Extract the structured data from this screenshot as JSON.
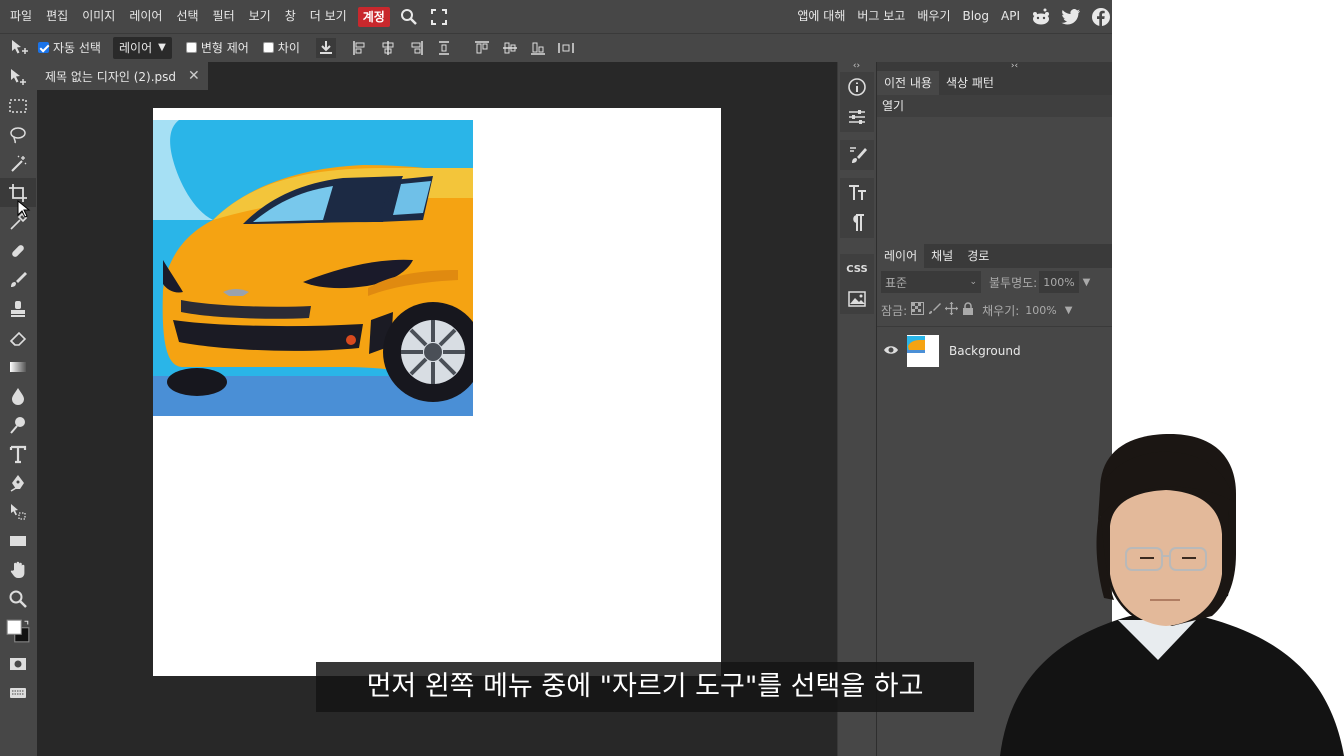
{
  "menu": {
    "items": [
      "파일",
      "편집",
      "이미지",
      "레이어",
      "선택",
      "필터",
      "보기",
      "창",
      "더 보기"
    ],
    "account_label": "계정",
    "right_items": [
      "앱에 대해",
      "버그 보고",
      "배우기",
      "Blog",
      "API"
    ]
  },
  "options": {
    "auto_select_label": "자동 선택",
    "auto_select_checked": true,
    "target_select": "레이어",
    "transform_label": "변형 제어",
    "diff_label": "차이"
  },
  "document": {
    "tab_title": "제목 없는 디자인 (2).psd",
    "close_glyph": "✕"
  },
  "panels": {
    "top_tabs": [
      "이전 내용",
      "색상 패턴"
    ],
    "history_items": [
      "열기"
    ],
    "layer_tabs": [
      "레이어",
      "채널",
      "경로"
    ],
    "blend_mode": "표준",
    "opacity_label": "불투명도:",
    "opacity_value": "100%",
    "lock_label": "잠금:",
    "fill_label": "채우기:",
    "fill_value": "100%",
    "layers": [
      {
        "name": "Background",
        "visible": true
      }
    ]
  },
  "strip": {
    "css_label": "CSS"
  },
  "subtitle": "먼저 왼쪽 메뉴 중에 \"자르기 도구\"를 선택을 하고",
  "colors": {
    "accent_account": "#c8282d",
    "workspace": "#282828",
    "chrome": "#474747"
  }
}
